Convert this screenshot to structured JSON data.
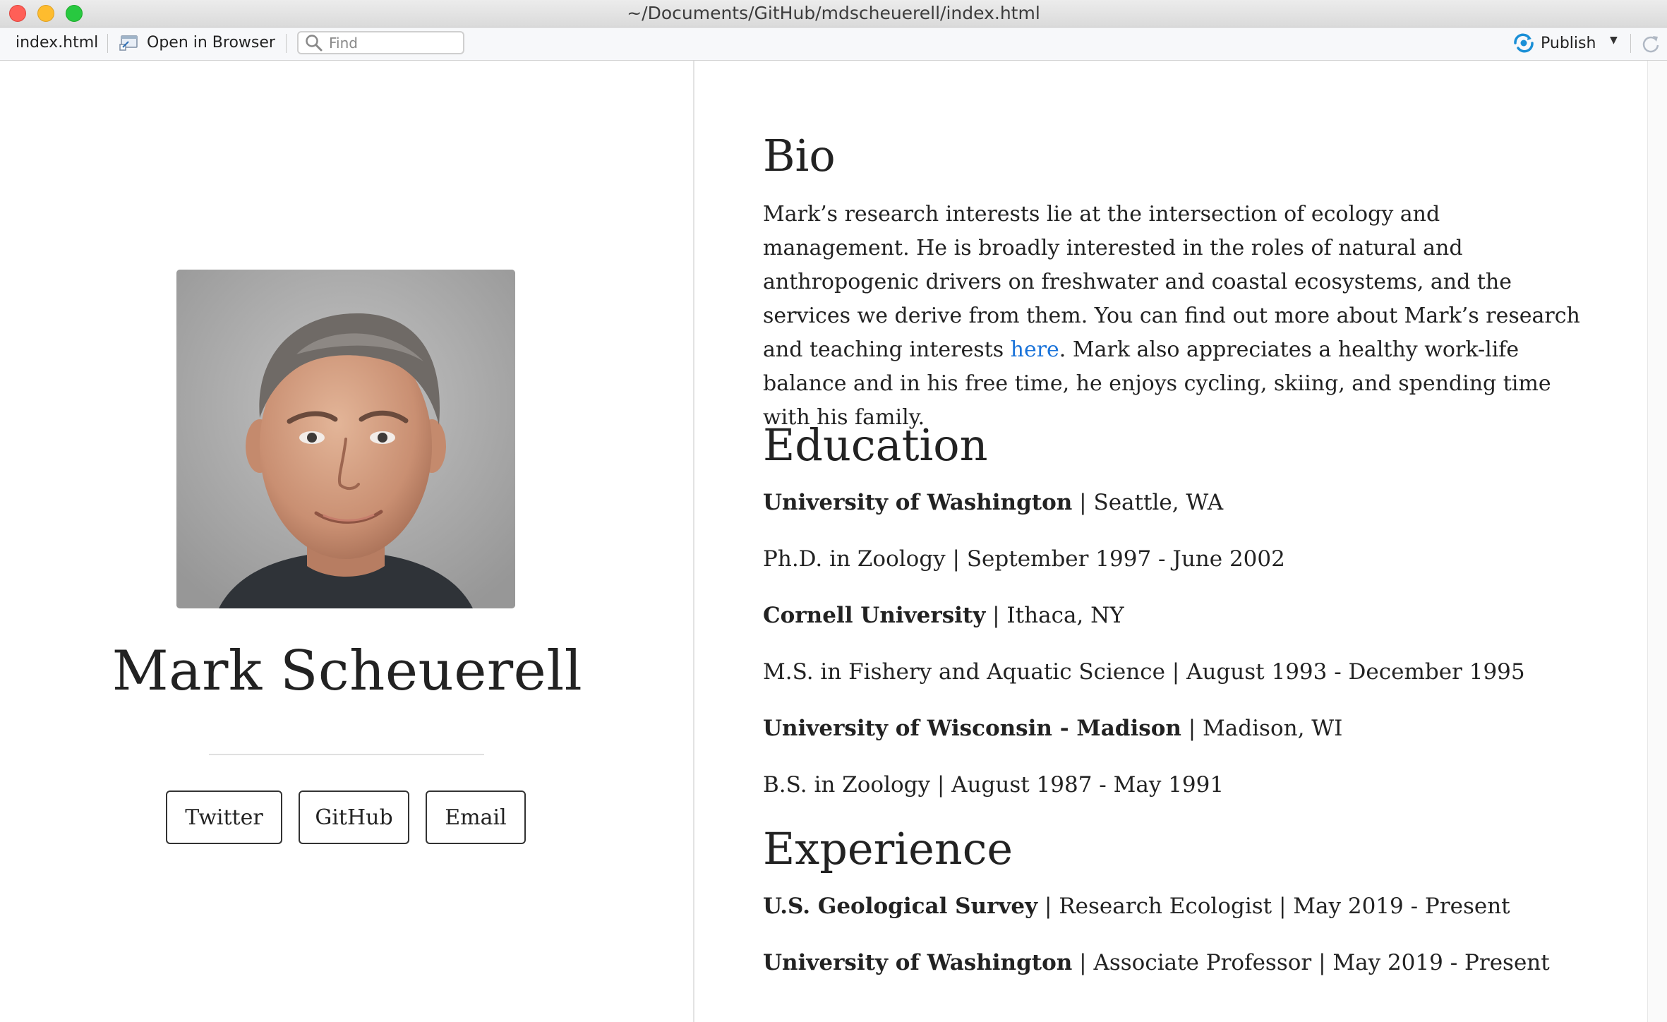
{
  "window": {
    "title": "~/Documents/GitHub/mdscheuerell/index.html"
  },
  "toolbar": {
    "file_label": "index.html",
    "open_in_browser": "Open in Browser",
    "find_placeholder": "Find",
    "publish": "Publish"
  },
  "profile": {
    "name": "Mark Scheuerell",
    "buttons": {
      "twitter": "Twitter",
      "github": "GitHub",
      "email": "Email"
    }
  },
  "bio": {
    "heading": "Bio",
    "text_before_link": "Mark’s research interests lie at the intersection of ecology and management. He is broadly interested in the roles of natural and anthropogenic drivers on freshwater and coastal ecosystems, and the services we derive from them. You can find out more about Mark’s research and teaching interests ",
    "link_text": "here",
    "text_after_link": ". Mark also appreciates a healthy work-life balance and in his free time, he enjoys cycling, skiing, and spending time with his family."
  },
  "education": {
    "heading": "Education",
    "entries": [
      {
        "school": "University of Washington",
        "location": " | Seattle, WA",
        "degree": "Ph.D. in Zoology | September 1997 - June 2002"
      },
      {
        "school": "Cornell University",
        "location": " | Ithaca, NY",
        "degree": "M.S. in Fishery and Aquatic Science | August 1993 - December 1995"
      },
      {
        "school": "University of Wisconsin - Madison",
        "location": " | Madison, WI",
        "degree": "B.S. in Zoology | August 1987 - May 1991"
      }
    ]
  },
  "experience": {
    "heading": "Experience",
    "entries": [
      {
        "org": "U.S. Geological Survey",
        "detail": " | Research Ecologist | May 2019 - Present"
      },
      {
        "org": "University of Washington",
        "detail": " | Associate Professor | May 2019 - Present"
      }
    ]
  },
  "colors": {
    "link": "#1a73d9",
    "publish_icon": "#1a8fd6"
  }
}
